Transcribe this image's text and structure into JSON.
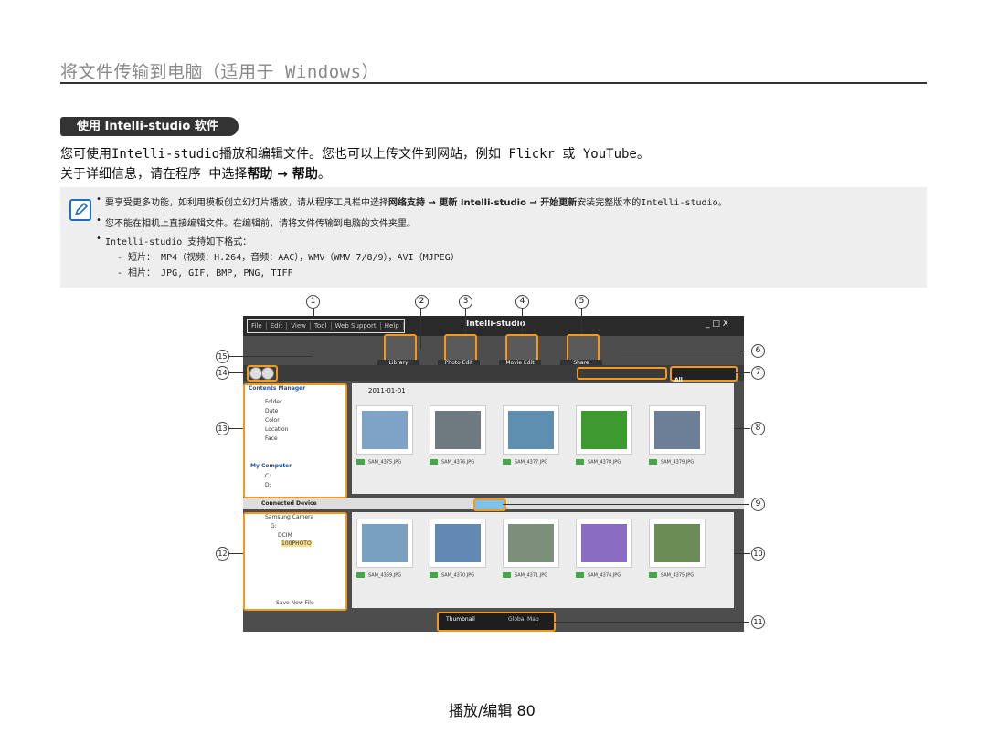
{
  "page": {
    "title": "将文件传输到电脑（适用于 Windows）",
    "section_tab": "使用 Intelli-studio 软件",
    "intro_line1": "您可使用Intelli-studio播放和编辑文件。您也可以上传文件到网站，例如 Flickr 或 YouTube。",
    "intro_line2_prefix": "关于详细信息，请在程序 中选择",
    "intro_line2_bold": "帮助 → 帮助",
    "intro_line2_suffix": "。",
    "footer": "播放/编辑  80"
  },
  "note": {
    "line1_prefix": "要享受更多功能，如利用模板创立幻灯片播放，请从程序工具栏中选择",
    "line1_bold1": "网络支持 → 更新 Intelli-studio → 开始更新",
    "line1_suffix": "安装完整版本的Intelli-studio。",
    "line2": "您不能在相机上直接编辑文件。在编辑前，请将文件传输到电脑的文件夹里。",
    "line3": "Intelli-studio 支持如下格式：",
    "line4": "- 短片： MP4（视频：H.264，音频：AAC），WMV（WMV 7/8/9），AVI（MJPEG）",
    "line5": "- 相片： JPG, GIF, BMP, PNG, TIFF"
  },
  "app": {
    "menu": [
      "File",
      "Edit",
      "View",
      "Tool",
      "Web Support",
      "Help"
    ],
    "brand": "Intelli-studio",
    "window_controls": "_ □ X",
    "buttons": [
      "Library",
      "Photo Edit",
      "Movie Edit",
      "Share"
    ],
    "view_tabs": [
      "All"
    ],
    "contents_manager": "Contents Manager",
    "contents_items": [
      "Folder",
      "Date",
      "Color",
      "Location",
      "Face"
    ],
    "my_computer": "My Computer",
    "drives": [
      "C:",
      "D:"
    ],
    "date_label": "2011-01-01",
    "top_files": [
      "SAM_4375.JPG",
      "SAM_4376.JPG",
      "SAM_4377.JPG",
      "SAM_4378.JPG",
      "SAM_4379.JPG"
    ],
    "connected_device": "Connected Device",
    "device_tree": [
      "Samsung Camera",
      "G:",
      "DCIM",
      "100PHOTO"
    ],
    "save_new_file": "Save New File",
    "bottom_files": [
      "SAM_4369.JPG",
      "SAM_4370.JPG",
      "SAM_4371.JPG",
      "SAM_4374.JPG",
      "SAM_4375.JPG"
    ],
    "bottom_tabs": [
      "Thumbnail",
      "Global Map"
    ]
  },
  "callouts": [
    "1",
    "2",
    "3",
    "4",
    "5",
    "6",
    "7",
    "8",
    "9",
    "10",
    "11",
    "12",
    "13",
    "14",
    "15"
  ]
}
